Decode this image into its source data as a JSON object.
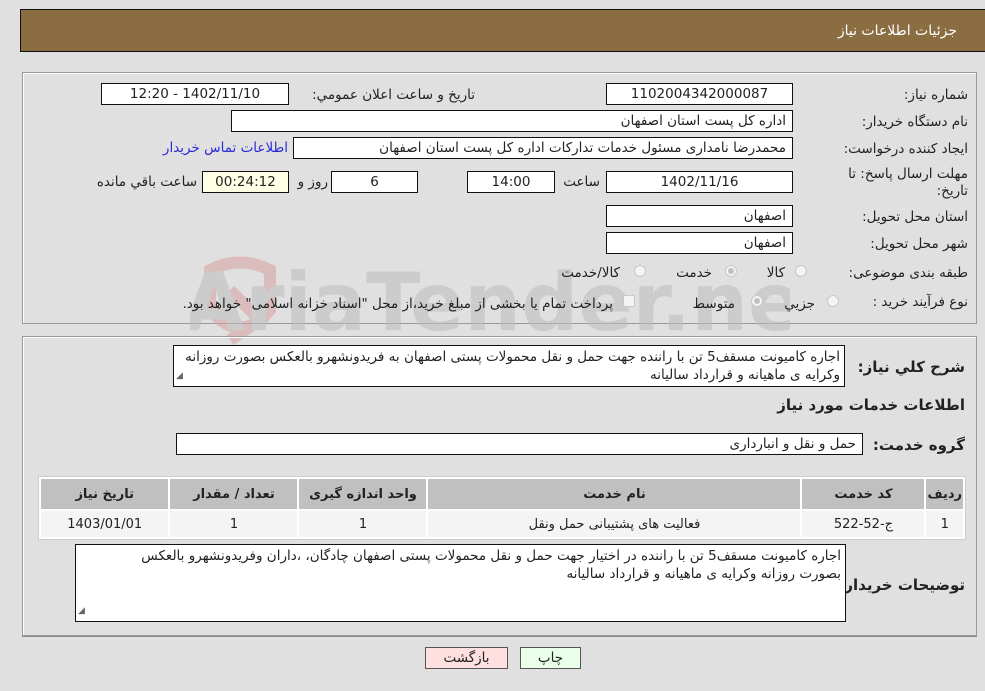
{
  "header": {
    "title": "جزئیات اطلاعات نیاز"
  },
  "fields": {
    "need_number": {
      "label": "شماره نیاز:",
      "value": "1102004342000087"
    },
    "announce": {
      "label": "تاریخ و ساعت اعلان عمومي:",
      "value": "1402/11/10 - 12:20"
    },
    "buyer_org": {
      "label": "نام دستگاه خریدار:",
      "value": "اداره کل پست استان اصفهان"
    },
    "requester": {
      "label": "ایجاد کننده درخواست:",
      "value": "محمدرضا نامداری مسئول خدمات تدارکات اداره کل پست استان اصفهان",
      "contact_link": "اطلاعات تماس خریدار"
    },
    "deadline": {
      "label_line1": "مهلت ارسال پاسخ: تا",
      "label_line2": "تاریخ:",
      "date": "1402/11/16",
      "time_label": "ساعت",
      "time": "14:00",
      "days": "6",
      "days_label": "روز و",
      "remaining": "00:24:12",
      "remaining_label": "ساعت باقي مانده"
    },
    "province": {
      "label": "استان محل تحویل:",
      "value": "اصفهان"
    },
    "city": {
      "label": "شهر محل تحویل:",
      "value": "اصفهان"
    },
    "category": {
      "label": "طبقه بندی موضوعی:",
      "options": [
        "کالا",
        "خدمت",
        "کالا/خدمت"
      ],
      "selected": "خدمت"
    },
    "purchase_type": {
      "label": "نوع فرآیند خرید :",
      "options": [
        "جزیي",
        "متوسط"
      ],
      "selected": "متوسط",
      "treasury_note": "پرداخت تمام یا بخشی از مبلغ خرید،از محل \"اسناد خزانه اسلامی\" خواهد بود."
    }
  },
  "description": {
    "label": "شرح کلي نیاز:",
    "value": "اجاره کامیونت مسقف5 تن با راننده جهت حمل و نقل محمولات پستی  اصفهان  به فریدونشهرو بالعکس بصورت روزانه وکرایه ی ماهیانه و قرارداد سالیانه"
  },
  "services": {
    "heading": "اطلاعات خدمات مورد نیاز",
    "group_label": "گروه خدمت:",
    "group_value": "حمل و نقل و انبارداری",
    "columns": [
      "ردیف",
      "کد خدمت",
      "نام خدمت",
      "واحد اندازه گیری",
      "تعداد / مقدار",
      "تاریخ نیاز"
    ],
    "rows": [
      [
        "1",
        "ج-52-522",
        "فعالیت های پشتیبانی حمل ونقل",
        "1",
        "1",
        "1403/01/01"
      ]
    ]
  },
  "buyer_notes": {
    "label": "توضیحات خریدار:",
    "value": "اجاره کامیونت مسقف5 تن با راننده در اختیار جهت حمل و نقل محمولات پستی  اصفهان چادگان، ،داران وفریدونشهرو بالعکس بصورت روزانه وکرایه ی ماهیانه و قرارداد سالیانه"
  },
  "buttons": {
    "print": "چاپ",
    "back": "بازگشت"
  },
  "watermark": {
    "text": "AriaTender.neT"
  }
}
